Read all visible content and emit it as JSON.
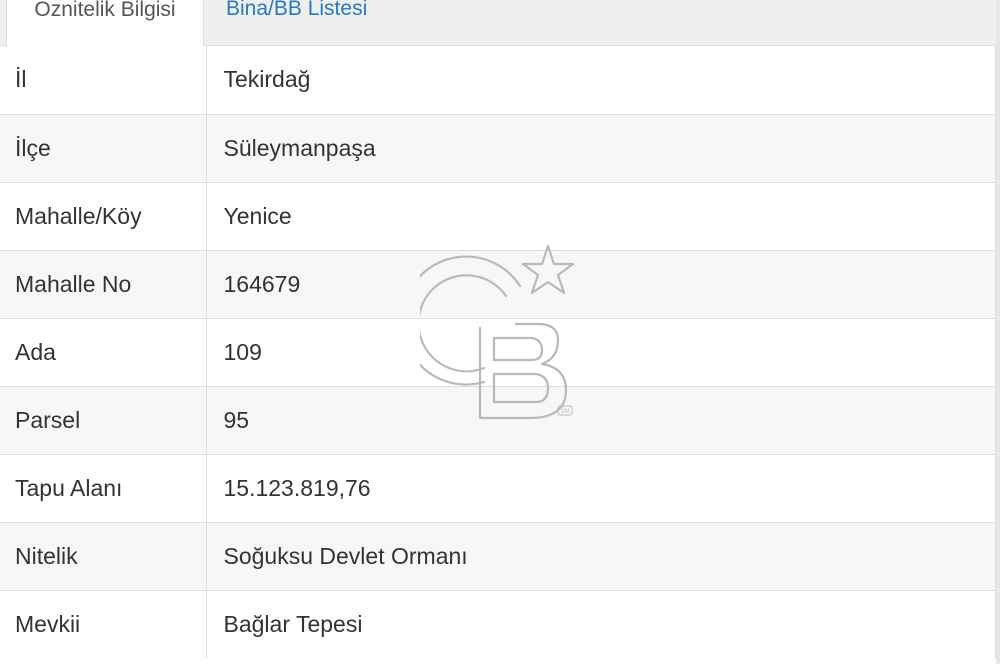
{
  "tabs": [
    {
      "label": "Öznitelik Bilgisi",
      "active": true
    },
    {
      "label": "Bina/BB Listesi",
      "active": false
    }
  ],
  "colors": {
    "link": "#2a78c2",
    "row_stripe": "#f7f7f7",
    "border": "#dddddd"
  },
  "watermark": {
    "icon": "cb-logo-star",
    "text": "CB",
    "mark": "SM"
  },
  "rows": [
    {
      "label": "İl",
      "value": "Tekirdağ"
    },
    {
      "label": "İlçe",
      "value": "Süleymanpaşa"
    },
    {
      "label": "Mahalle/Köy",
      "value": "Yenice"
    },
    {
      "label": "Mahalle No",
      "value": "164679"
    },
    {
      "label": "Ada",
      "value": "109"
    },
    {
      "label": "Parsel",
      "value": "95"
    },
    {
      "label": "Tapu Alanı",
      "value": "15.123.819,76"
    },
    {
      "label": "Nitelik",
      "value": "Soğuksu Devlet Ormanı"
    },
    {
      "label": "Mevkii",
      "value": "Bağlar Tepesi"
    }
  ]
}
